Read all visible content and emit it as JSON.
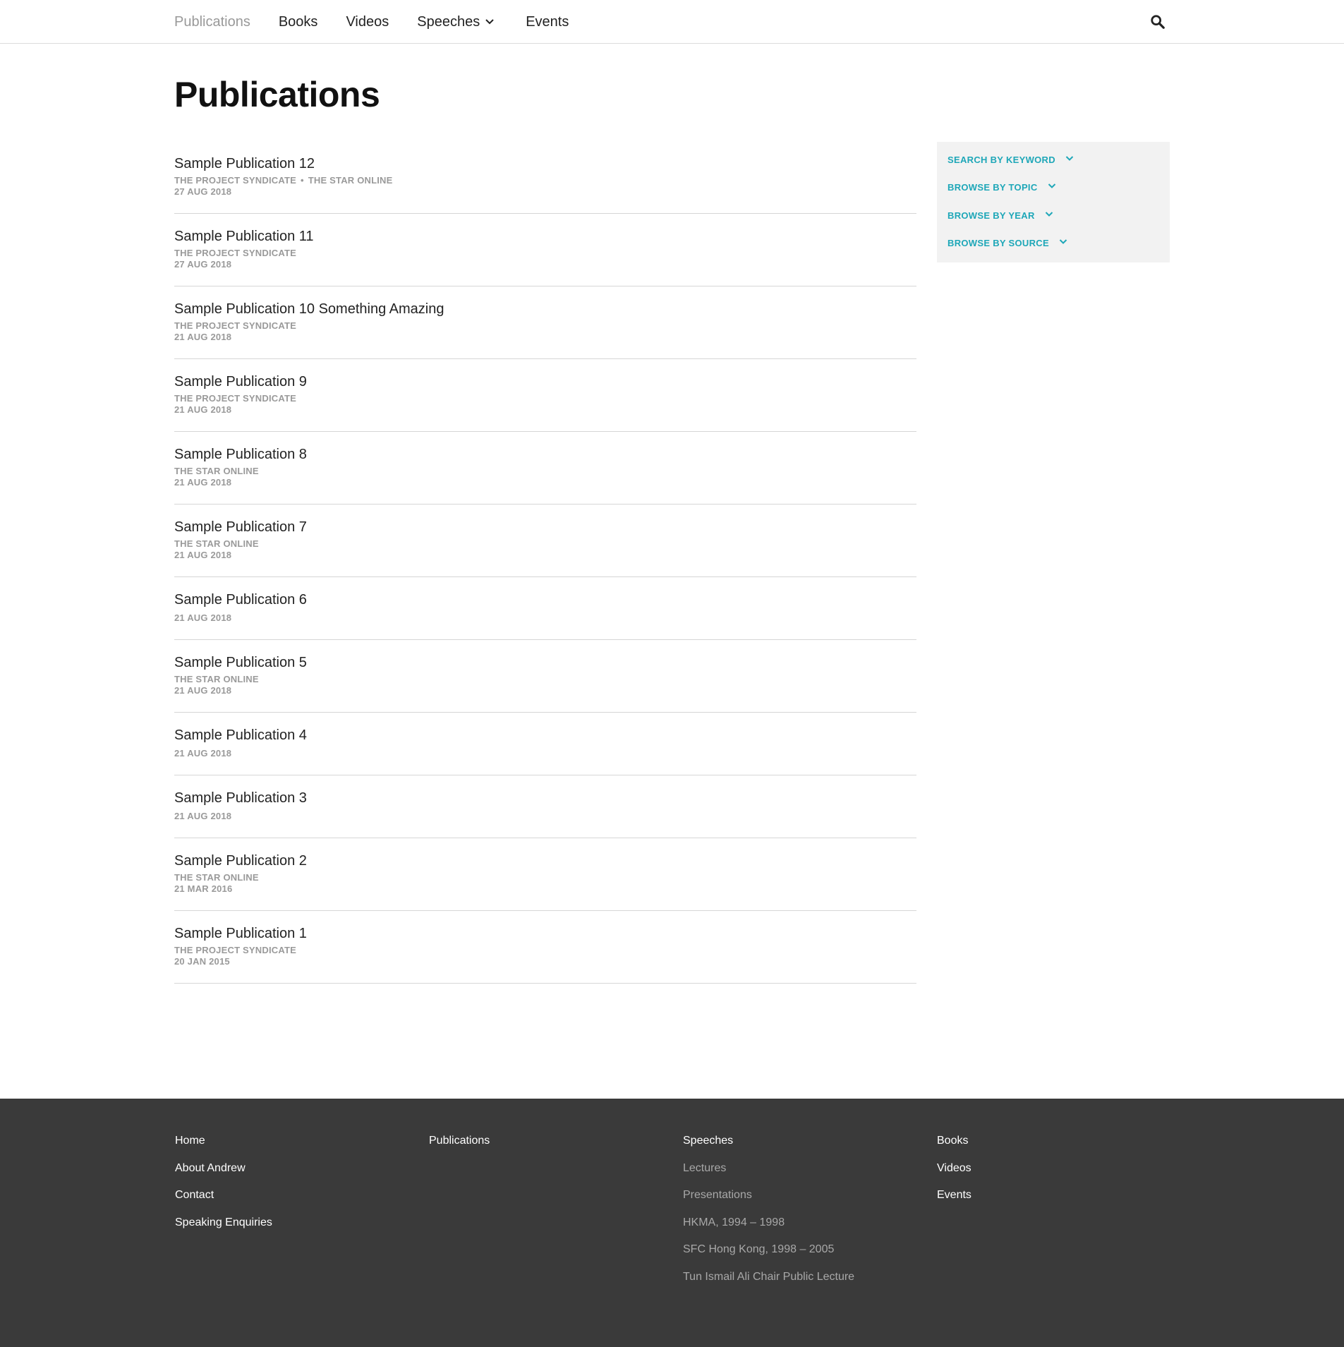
{
  "nav": {
    "items": [
      {
        "label": "Publications"
      },
      {
        "label": "Books"
      },
      {
        "label": "Videos"
      },
      {
        "label": "Speeches"
      },
      {
        "label": "Events"
      }
    ],
    "search_icon": "search-icon"
  },
  "page": {
    "title": "Publications"
  },
  "publications": [
    {
      "title": "Sample Publication 12",
      "sources": [
        "THE PROJECT SYNDICATE",
        "THE STAR ONLINE"
      ],
      "date": "27 AUG 2018"
    },
    {
      "title": "Sample Publication 11",
      "sources": [
        "THE PROJECT SYNDICATE"
      ],
      "date": "27 AUG 2018"
    },
    {
      "title": "Sample Publication 10 Something Amazing",
      "sources": [
        "THE PROJECT SYNDICATE"
      ],
      "date": "21 AUG 2018"
    },
    {
      "title": "Sample Publication 9",
      "sources": [
        "THE PROJECT SYNDICATE"
      ],
      "date": "21 AUG 2018"
    },
    {
      "title": "Sample Publication 8",
      "sources": [
        "THE STAR ONLINE"
      ],
      "date": "21 AUG 2018"
    },
    {
      "title": "Sample Publication 7",
      "sources": [
        "THE STAR ONLINE"
      ],
      "date": "21 AUG 2018"
    },
    {
      "title": "Sample Publication 6",
      "sources": [],
      "date": "21 AUG 2018"
    },
    {
      "title": "Sample Publication 5",
      "sources": [
        "THE STAR ONLINE"
      ],
      "date": "21 AUG 2018"
    },
    {
      "title": "Sample Publication 4",
      "sources": [],
      "date": "21 AUG 2018"
    },
    {
      "title": "Sample Publication 3",
      "sources": [],
      "date": "21 AUG 2018"
    },
    {
      "title": "Sample Publication 2",
      "sources": [
        "THE STAR ONLINE"
      ],
      "date": "21 MAR 2016"
    },
    {
      "title": "Sample Publication 1",
      "sources": [
        "THE PROJECT SYNDICATE"
      ],
      "date": "20 JAN 2015"
    }
  ],
  "filters": [
    {
      "label": "SEARCH BY KEYWORD"
    },
    {
      "label": "BROWSE BY TOPIC"
    },
    {
      "label": "BROWSE BY YEAR"
    },
    {
      "label": "BROWSE BY SOURCE"
    }
  ],
  "footer": {
    "col1": [
      "Home",
      "About Andrew",
      "Contact",
      "Speaking Enquiries"
    ],
    "col2": [
      "Publications"
    ],
    "col3": {
      "heading": "Speeches",
      "sub": [
        "Lectures",
        "Presentations",
        "HKMA, 1994 – 1998",
        "SFC Hong Kong, 1998 – 2005",
        "Tun Ismail Ali Chair Public Lecture"
      ]
    },
    "col4": [
      "Books",
      "Videos",
      "Events"
    ]
  },
  "colors": {
    "accent": "#1ea7b8",
    "footer_bg": "#3a3a3a",
    "filter_bg": "#f2f2f2",
    "meta_gray": "#9a9a9a"
  }
}
